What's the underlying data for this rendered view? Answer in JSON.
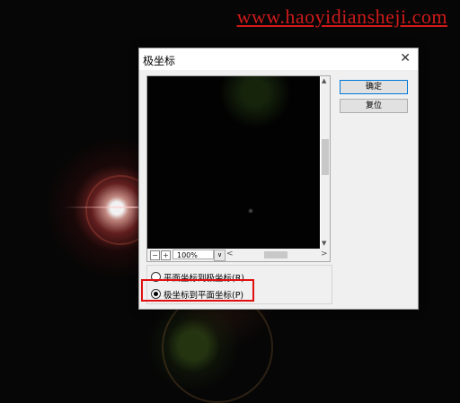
{
  "watermark": "www.haoyidiansheji.com",
  "dialog": {
    "title": "极坐标",
    "close_glyph": "✕"
  },
  "preview": {
    "zoom_value": "100%",
    "zoom_out_glyph": "−",
    "zoom_in_glyph": "+",
    "dropdown_glyph": "∨",
    "scroll_left_glyph": "<",
    "scroll_right_glyph": ">",
    "scroll_up_glyph": "▲",
    "scroll_down_glyph": "▼"
  },
  "buttons": {
    "ok_label": "确定",
    "reset_label": "复位"
  },
  "options": {
    "rect_to_polar": "平面坐标到极坐标(R)",
    "polar_to_rect": "极坐标到平面坐标(P)",
    "selected": "polar_to_rect"
  },
  "colors": {
    "watermark": "#d11a1a",
    "highlight_box": "#e01010",
    "primary_button_border": "#0078d7"
  }
}
